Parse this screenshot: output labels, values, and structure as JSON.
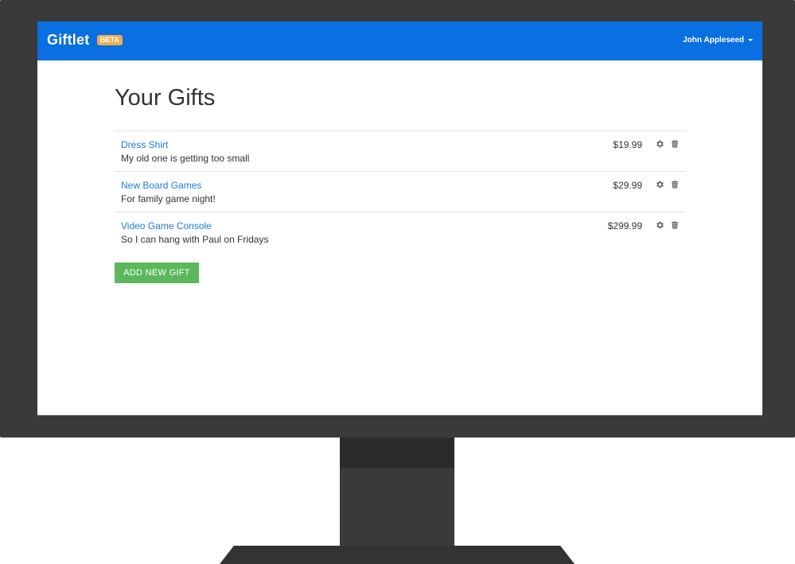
{
  "app": {
    "brand": "Giftlet",
    "badge": "BETA",
    "user_name": "John Appleseed"
  },
  "page": {
    "title": "Your Gifts"
  },
  "gifts": [
    {
      "name": "Dress Shirt",
      "description": "My old one is getting too small",
      "price": "$19.99"
    },
    {
      "name": "New Board Games",
      "description": "For family game night!",
      "price": "$29.99"
    },
    {
      "name": "Video Game Console",
      "description": "So I can hang with Paul on Fridays",
      "price": "$299.99"
    }
  ],
  "actions": {
    "add_label": "ADD NEW GIFT"
  },
  "icons": {
    "edit": "gear-icon",
    "delete": "trash-icon",
    "user_menu": "caret-down-icon"
  },
  "colors": {
    "navbar": "#0a6fe0",
    "badge": "#f0ad4e",
    "link": "#1f7ad6",
    "add_button": "#5cb85c",
    "bezel": "#3a3a3a"
  }
}
